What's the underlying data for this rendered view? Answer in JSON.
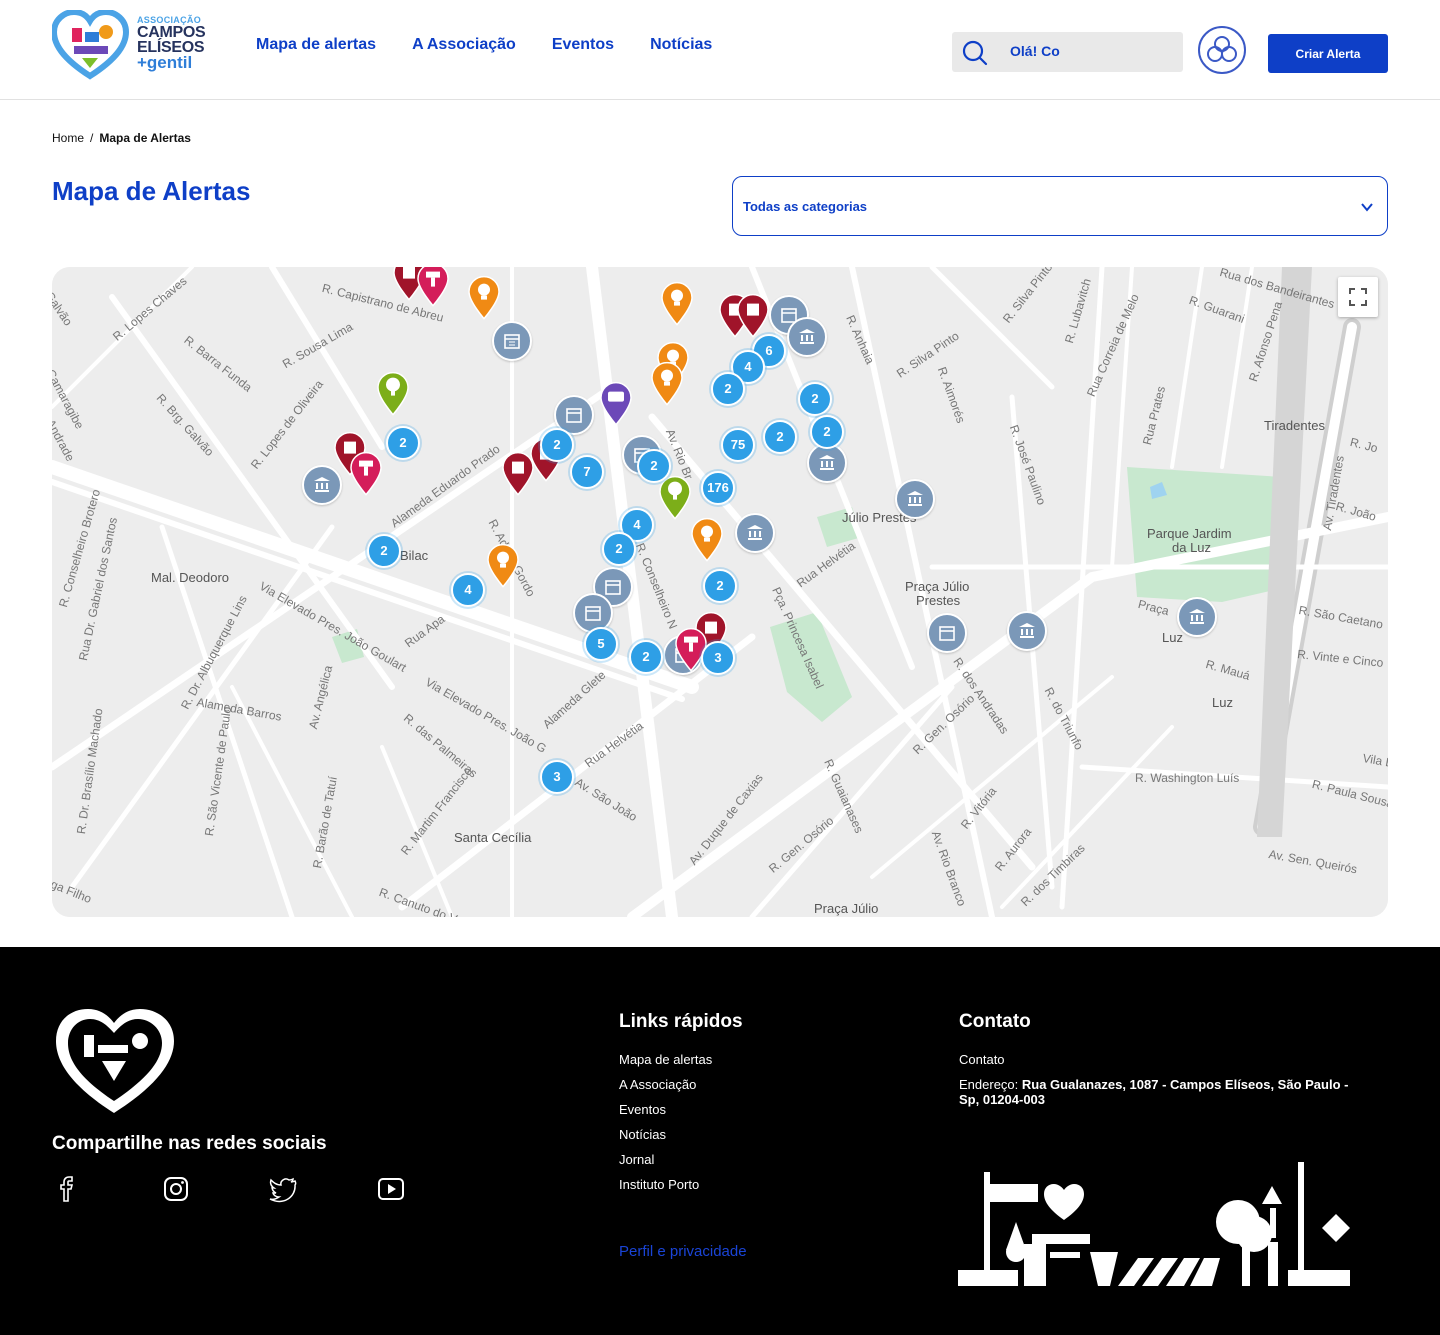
{
  "header": {
    "logo": {
      "small": "ASSOCIAÇÃO",
      "line1": "CAMPOS",
      "line2": "ELÍSEOS",
      "line3": "+gentil"
    },
    "nav": [
      "Mapa de alertas",
      "A Associação",
      "Eventos",
      "Notícias"
    ],
    "greeting": "Olá! Co",
    "cta": "Criar Alerta"
  },
  "breadcrumb": {
    "home": "Home",
    "separator": "/",
    "current": "Mapa de Alertas"
  },
  "page_title": "Mapa de Alertas",
  "category_select": {
    "selected": "Todas as categorias"
  },
  "map": {
    "places": {
      "tiradentes": "Tiradentes",
      "parque1": "Parque Jardim",
      "parque2": "da Luz",
      "julio_prestes": "Júlio Prestes",
      "praca_julio1": "Praça Júlio",
      "praca_julio2": "Prestes",
      "mal_deodoro": "Mal. Deodoro",
      "santa_cecilia": "Santa Cecília",
      "luz": "Luz",
      "luz2": "Luz",
      "bilac": "Bilac",
      "praca_julio_bottom": "Praça Júlio"
    },
    "streets": {
      "s1": "R. Capistrano de Abreu",
      "s2": "R. Lopes Chaves",
      "s3": "R. Sousa Lima",
      "s4": "R. Barra Funda",
      "s5": "R. Brg. Galvão",
      "s6": "R. Lopes de Oliveira",
      "s7": "Alameda Eduardo Prado",
      "s8": "R. Adolfo Gordo",
      "s9": "Via Elevado Pres. João Goulart",
      "s10": "Via Elevado Pres. João G",
      "s11": "Alameda Barros",
      "s12": "Av. Angélica",
      "s13": "R. das Palmeiras",
      "s14": "R. Martim Francisco",
      "s15": "R. Canuto do Val",
      "s16": "Alameda Glete",
      "s17": "Rua Helvétia",
      "s18": "Av. São João",
      "s19": "Av. Duque de Caxias",
      "s20": "R. Gen. Osório",
      "s21": "Pça. Princesa Isabel",
      "s22": "R. Guaianases",
      "s23": "Av. Rio Branco",
      "s24": "R. Vitória",
      "s25": "R. Aurora",
      "s26": "R. dos Timbiras",
      "s27": "R. dos Andradas",
      "s28": "R. do Triunfo",
      "s29": "R. Washington Luís",
      "s30": "Av. Sen. Queirós",
      "s31": "R. Paula Sousa",
      "s32": "R. José Paulino",
      "s33": "Rua Prates",
      "s34": "R. Silva Pinto",
      "s35": "R. Anhaia",
      "s36": "R. Lubavitch",
      "s37": "Rua Correia de Melo",
      "s38": "R. Afonso Pena",
      "s39": "R. Guarani",
      "s40": "Rua dos Bandeirantes",
      "s41": "Av. Tiradentes",
      "s42": "R. São Caetano",
      "s43": "R. Vinte e Cinco",
      "s44": "R. Mauá",
      "s45": "Rua Apa",
      "s46": "R. Dr. Brasílio Machado",
      "s47": "R. São Vicente de Paulo",
      "s48": "R. Barão de Tatuí",
      "s49": "Rua Dr. Gabriel dos Santos",
      "s50": "R. Conselheiro Brotero",
      "s51": "R. Dr. Albuquerque Lins",
      "s52": "R. Conselheiro N",
      "s53": "Av. Rio Br",
      "s54": "Praça",
      "s55": "R. João",
      "s56": "Rua Helvétia",
      "s57": "R. Gen. Osório",
      "s58": "Camaragibe",
      "s59": "Andrade",
      "s60": "R. Jo",
      "s61": "Vila B",
      "s62": "Galvão",
      "s63": "ga Filho",
      "s64": "R. Silva Pinto",
      "s65": "R. Aimorés"
    },
    "clusters": [
      "2",
      "6",
      "4",
      "2",
      "2",
      "2",
      "2",
      "75",
      "2",
      "7",
      "2",
      "176",
      "4",
      "2",
      "2",
      "2",
      "4",
      "5",
      "2",
      "3",
      "3"
    ],
    "fullscreen_icon": "fullscreen-icon"
  },
  "footer": {
    "share_title": "Compartilhe nas redes sociais",
    "social": [
      "facebook-icon",
      "instagram-icon",
      "twitter-icon",
      "youtube-icon"
    ],
    "quick_links_title": "Links rápidos",
    "quick_links": [
      "Mapa de alertas",
      "A Associação",
      "Eventos",
      "Notícias",
      "Jornal",
      "Instituto Porto"
    ],
    "privacy": "Perfil e privacidade",
    "contact_title": "Contato",
    "contact_label": "Contato",
    "address_label": "Endereço:",
    "address": "Rua Gualanazes, 1087 - Campos Elíseos, São Paulo - Sp, 01204-003"
  },
  "colors": {
    "brand": "#0e3fc7",
    "cluster": "#2e9fe6",
    "institution": "#7b98b8",
    "footer_bg": "#000000"
  }
}
